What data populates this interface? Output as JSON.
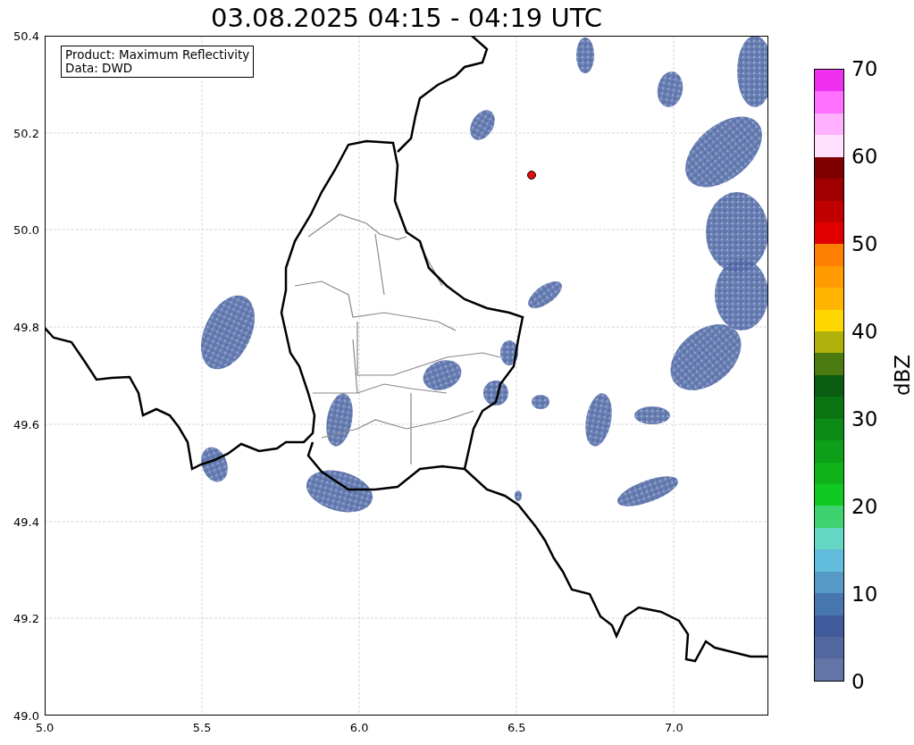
{
  "title": "03.08.2025 04:15 - 04:19 UTC",
  "legend": {
    "lines": [
      "Product: Maximum Reflectivity",
      "Data: DWD"
    ]
  },
  "x_axis": {
    "ticks": [
      "5.0",
      "5.5",
      "6.0",
      "6.5",
      "7.0"
    ]
  },
  "y_axis": {
    "ticks": [
      "50.4",
      "50.2",
      "50.0",
      "49.8",
      "49.6",
      "49.4",
      "49.2",
      "49.0"
    ]
  },
  "colorbar": {
    "label": "dBZ",
    "ticks": [
      "70",
      "60",
      "50",
      "40",
      "30",
      "20",
      "10",
      "0"
    ],
    "segments": [
      {
        "color": "#f030f0"
      },
      {
        "color": "#ff70ff"
      },
      {
        "color": "#ffb0ff"
      },
      {
        "color": "#ffe0ff"
      },
      {
        "color": "#800000"
      },
      {
        "color": "#a00000"
      },
      {
        "color": "#c00000"
      },
      {
        "color": "#e00000"
      },
      {
        "color": "#ff7f00"
      },
      {
        "color": "#ff9a00"
      },
      {
        "color": "#ffb400"
      },
      {
        "color": "#ffd700"
      },
      {
        "color": "#b0b00a"
      },
      {
        "color": "#4b7a10"
      },
      {
        "color": "#0a5c10"
      },
      {
        "color": "#0a7413"
      },
      {
        "color": "#0b8a14"
      },
      {
        "color": "#0e9f18"
      },
      {
        "color": "#10b21a"
      },
      {
        "color": "#10c921"
      },
      {
        "color": "#3ed36e"
      },
      {
        "color": "#63d6c4"
      },
      {
        "color": "#62bcdc"
      },
      {
        "color": "#559ac6"
      },
      {
        "color": "#4876ae"
      },
      {
        "color": "#425b9c"
      },
      {
        "color": "#53679f"
      },
      {
        "color": "#6374a6"
      }
    ]
  }
}
